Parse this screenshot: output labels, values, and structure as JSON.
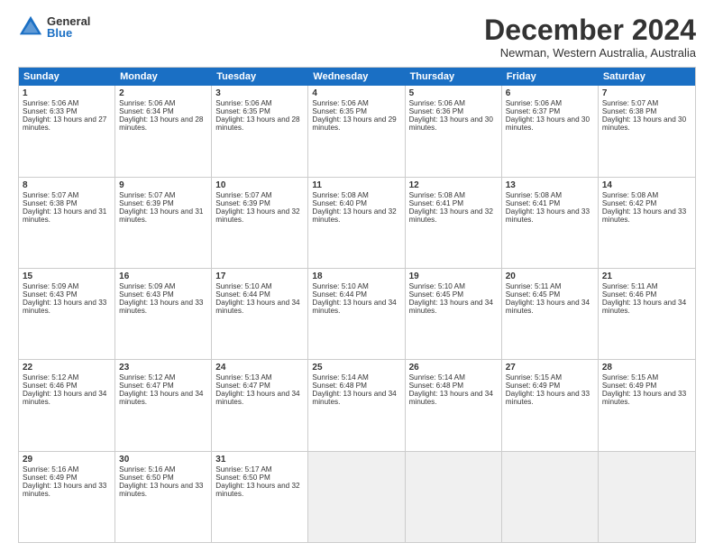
{
  "logo": {
    "general": "General",
    "blue": "Blue"
  },
  "title": {
    "month": "December 2024",
    "location": "Newman, Western Australia, Australia"
  },
  "days": [
    "Sunday",
    "Monday",
    "Tuesday",
    "Wednesday",
    "Thursday",
    "Friday",
    "Saturday"
  ],
  "weeks": [
    [
      {
        "day": 1,
        "sunrise": "5:06 AM",
        "sunset": "6:33 PM",
        "daylight": "13 hours and 27 minutes."
      },
      {
        "day": 2,
        "sunrise": "5:06 AM",
        "sunset": "6:34 PM",
        "daylight": "13 hours and 28 minutes."
      },
      {
        "day": 3,
        "sunrise": "5:06 AM",
        "sunset": "6:35 PM",
        "daylight": "13 hours and 28 minutes."
      },
      {
        "day": 4,
        "sunrise": "5:06 AM",
        "sunset": "6:35 PM",
        "daylight": "13 hours and 29 minutes."
      },
      {
        "day": 5,
        "sunrise": "5:06 AM",
        "sunset": "6:36 PM",
        "daylight": "13 hours and 30 minutes."
      },
      {
        "day": 6,
        "sunrise": "5:06 AM",
        "sunset": "6:37 PM",
        "daylight": "13 hours and 30 minutes."
      },
      {
        "day": 7,
        "sunrise": "5:07 AM",
        "sunset": "6:38 PM",
        "daylight": "13 hours and 30 minutes."
      }
    ],
    [
      {
        "day": 8,
        "sunrise": "5:07 AM",
        "sunset": "6:38 PM",
        "daylight": "13 hours and 31 minutes."
      },
      {
        "day": 9,
        "sunrise": "5:07 AM",
        "sunset": "6:39 PM",
        "daylight": "13 hours and 31 minutes."
      },
      {
        "day": 10,
        "sunrise": "5:07 AM",
        "sunset": "6:39 PM",
        "daylight": "13 hours and 32 minutes."
      },
      {
        "day": 11,
        "sunrise": "5:08 AM",
        "sunset": "6:40 PM",
        "daylight": "13 hours and 32 minutes."
      },
      {
        "day": 12,
        "sunrise": "5:08 AM",
        "sunset": "6:41 PM",
        "daylight": "13 hours and 32 minutes."
      },
      {
        "day": 13,
        "sunrise": "5:08 AM",
        "sunset": "6:41 PM",
        "daylight": "13 hours and 33 minutes."
      },
      {
        "day": 14,
        "sunrise": "5:08 AM",
        "sunset": "6:42 PM",
        "daylight": "13 hours and 33 minutes."
      }
    ],
    [
      {
        "day": 15,
        "sunrise": "5:09 AM",
        "sunset": "6:43 PM",
        "daylight": "13 hours and 33 minutes."
      },
      {
        "day": 16,
        "sunrise": "5:09 AM",
        "sunset": "6:43 PM",
        "daylight": "13 hours and 33 minutes."
      },
      {
        "day": 17,
        "sunrise": "5:10 AM",
        "sunset": "6:44 PM",
        "daylight": "13 hours and 34 minutes."
      },
      {
        "day": 18,
        "sunrise": "5:10 AM",
        "sunset": "6:44 PM",
        "daylight": "13 hours and 34 minutes."
      },
      {
        "day": 19,
        "sunrise": "5:10 AM",
        "sunset": "6:45 PM",
        "daylight": "13 hours and 34 minutes."
      },
      {
        "day": 20,
        "sunrise": "5:11 AM",
        "sunset": "6:45 PM",
        "daylight": "13 hours and 34 minutes."
      },
      {
        "day": 21,
        "sunrise": "5:11 AM",
        "sunset": "6:46 PM",
        "daylight": "13 hours and 34 minutes."
      }
    ],
    [
      {
        "day": 22,
        "sunrise": "5:12 AM",
        "sunset": "6:46 PM",
        "daylight": "13 hours and 34 minutes."
      },
      {
        "day": 23,
        "sunrise": "5:12 AM",
        "sunset": "6:47 PM",
        "daylight": "13 hours and 34 minutes."
      },
      {
        "day": 24,
        "sunrise": "5:13 AM",
        "sunset": "6:47 PM",
        "daylight": "13 hours and 34 minutes."
      },
      {
        "day": 25,
        "sunrise": "5:14 AM",
        "sunset": "6:48 PM",
        "daylight": "13 hours and 34 minutes."
      },
      {
        "day": 26,
        "sunrise": "5:14 AM",
        "sunset": "6:48 PM",
        "daylight": "13 hours and 34 minutes."
      },
      {
        "day": 27,
        "sunrise": "5:15 AM",
        "sunset": "6:49 PM",
        "daylight": "13 hours and 33 minutes."
      },
      {
        "day": 28,
        "sunrise": "5:15 AM",
        "sunset": "6:49 PM",
        "daylight": "13 hours and 33 minutes."
      }
    ],
    [
      {
        "day": 29,
        "sunrise": "5:16 AM",
        "sunset": "6:49 PM",
        "daylight": "13 hours and 33 minutes."
      },
      {
        "day": 30,
        "sunrise": "5:16 AM",
        "sunset": "6:50 PM",
        "daylight": "13 hours and 33 minutes."
      },
      {
        "day": 31,
        "sunrise": "5:17 AM",
        "sunset": "6:50 PM",
        "daylight": "13 hours and 32 minutes."
      },
      null,
      null,
      null,
      null
    ]
  ]
}
